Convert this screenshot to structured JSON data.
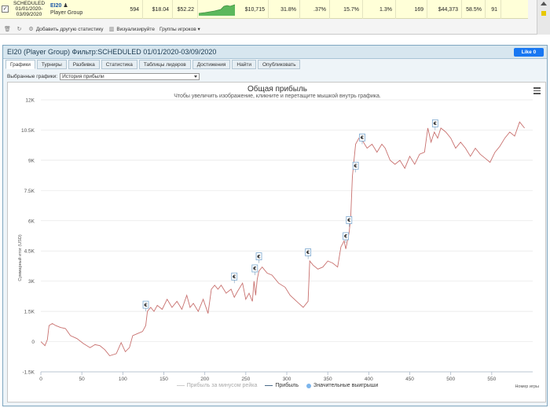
{
  "row": {
    "checkbox": "✓",
    "schedule": "SCHEDULED 01/01/2020-03/09/2020",
    "player_name": "EI20",
    "player_group": "Player Group",
    "cells": [
      "594",
      "$18.04",
      "$52.22",
      "$10,715",
      "31.8%",
      ".37%",
      "15.7%",
      "1.3%",
      "169",
      "$44,373",
      "58.5%",
      "91"
    ]
  },
  "toolbar": {
    "add_stat": "Добавить другую статистику",
    "visualize": "Визуализируйте",
    "player_groups": "Группы игроков"
  },
  "panel": {
    "title": "EI20 (Player Group) Фильтр:SCHEDULED 01/01/2020-03/09/2020",
    "fb_like": "Like 0",
    "tabs": [
      "Графики",
      "Турниры",
      "Разбивка",
      "Статистика",
      "Таблицы лидеров",
      "Достижения",
      "Найти",
      "Опубликовать"
    ],
    "selected_label": "Выбранные графики:",
    "selected_value": "История прибыли"
  },
  "chart_data": {
    "type": "line",
    "title": "Общая прибыль",
    "subtitle": "Чтобы увеличить изображение, кликните и перетащите мышкой внутрь графика.",
    "ylabel": "Суммарный итог (USD)",
    "xlabel": "Номер игры",
    "ylim": [
      -1500,
      12000
    ],
    "xlim": [
      0,
      600
    ],
    "yticks": [
      "12K",
      "10.5K",
      "9K",
      "7.5K",
      "6K",
      "4.5K",
      "3K",
      "1.5K",
      "0",
      "-1.5K"
    ],
    "ytick_values": [
      12000,
      10500,
      9000,
      7500,
      6000,
      4500,
      3000,
      1500,
      0,
      -1500
    ],
    "xticks": [
      "0",
      "50",
      "100",
      "150",
      "200",
      "250",
      "300",
      "350",
      "400",
      "450",
      "500",
      "550"
    ],
    "xtick_values": [
      0,
      50,
      100,
      150,
      200,
      250,
      300,
      350,
      400,
      450,
      500,
      550
    ],
    "series": [
      {
        "name": "Прибыль",
        "color": "#c8706e",
        "x": [
          0,
          5,
          8,
          10,
          14,
          18,
          24,
          30,
          36,
          44,
          52,
          60,
          66,
          72,
          78,
          84,
          92,
          98,
          103,
          108,
          112,
          118,
          124,
          128,
          130,
          134,
          138,
          142,
          148,
          154,
          160,
          166,
          172,
          178,
          182,
          186,
          192,
          198,
          204,
          208,
          212,
          216,
          220,
          226,
          232,
          236,
          240,
          246,
          250,
          254,
          258,
          260,
          262,
          264,
          266,
          270,
          276,
          282,
          290,
          298,
          304,
          312,
          320,
          326,
          328,
          332,
          338,
          344,
          350,
          356,
          362,
          366,
          370,
          372,
          376,
          378,
          380,
          384,
          388,
          392,
          398,
          404,
          410,
          416,
          420,
          426,
          432,
          438,
          444,
          450,
          456,
          462,
          468,
          472,
          476,
          480,
          484,
          488,
          494,
          500,
          506,
          512,
          518,
          524,
          530,
          536,
          542,
          548,
          554,
          560,
          566,
          572,
          578,
          584,
          590
        ],
        "y": [
          0,
          -200,
          100,
          800,
          900,
          800,
          700,
          650,
          300,
          150,
          -100,
          -300,
          -150,
          -200,
          -400,
          -700,
          -600,
          -50,
          -500,
          -300,
          300,
          400,
          500,
          800,
          1500,
          1700,
          1500,
          1800,
          1600,
          2100,
          1700,
          2000,
          1600,
          2300,
          1700,
          1900,
          1500,
          2100,
          1400,
          2600,
          2800,
          2600,
          2800,
          2400,
          2600,
          2200,
          2500,
          2900,
          2100,
          2400,
          2000,
          3000,
          2300,
          3100,
          3500,
          3700,
          3400,
          3300,
          2900,
          2700,
          2300,
          2000,
          1700,
          2000,
          4000,
          3800,
          3600,
          3700,
          4000,
          3900,
          3700,
          4700,
          5000,
          4600,
          5400,
          6200,
          8200,
          9800,
          10100,
          10000,
          9600,
          9800,
          9400,
          9800,
          9600,
          9000,
          8800,
          9000,
          8600,
          9200,
          8800,
          9300,
          9400,
          10600,
          9900,
          10400,
          10100,
          10600,
          10400,
          10100,
          9600,
          9900,
          9600,
          9200,
          9600,
          9300,
          9100,
          8900,
          9400,
          9700,
          10100,
          10400,
          10200,
          10900,
          10600
        ]
      }
    ],
    "big_wins_x": [
      128,
      236,
      261,
      266,
      326,
      372,
      376,
      384,
      392,
      481
    ],
    "big_wins_y": [
      1500,
      2900,
      3300,
      3900,
      4100,
      4900,
      5700,
      8400,
      9800,
      10500
    ],
    "legend": [
      "Прибыль за минусом рейка",
      "Прибыль",
      "Значительные выигрыши"
    ],
    "legend_colors": [
      "#cccccc",
      "#4a6a8a",
      "#7cb5ec"
    ],
    "marker_glyph": "€"
  }
}
